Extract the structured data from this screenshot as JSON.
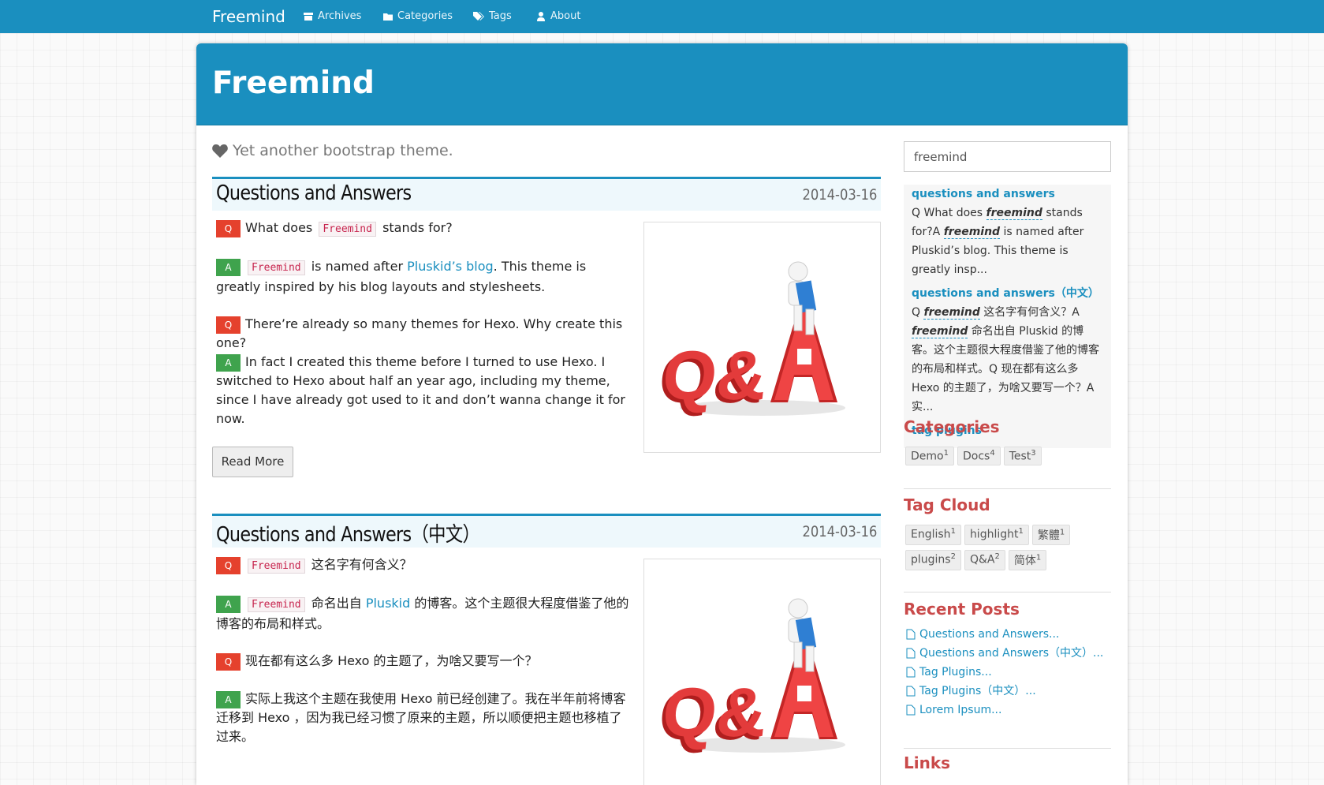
{
  "navbar": {
    "brand": "Freemind",
    "items": [
      {
        "label": "Archives",
        "icon": "archive-icon"
      },
      {
        "label": "Categories",
        "icon": "folder-icon"
      },
      {
        "label": "Tags",
        "icon": "tags-icon"
      },
      {
        "label": "About",
        "icon": "user-icon"
      }
    ]
  },
  "banner": {
    "title": "Freemind"
  },
  "subtitle": "Yet another bootstrap theme.",
  "posts": [
    {
      "title": "Questions and Answers",
      "date": "2014-03-16",
      "q1_kw": "Freemind",
      "q1_text": "stands for?",
      "q1_pre": "What does",
      "a1_kw": "Freemind",
      "a1_pre": "is named after",
      "a1_link": "Pluskid’s blog",
      "a1_text": ". This theme is greatly inspired by his blog layouts and stylesheets.",
      "q2_text": "There’re already so many themes for Hexo. Why create this one?",
      "a2_text": "In fact I created this theme before I turned to use Hexo. I switched to Hexo about half an year ago, including my theme, since I have already got used to it and don’t wanna change it for now.",
      "badge_q": "Q",
      "badge_a": "A",
      "read_more": "Read More"
    },
    {
      "title": "Questions and Answers（中文）",
      "date": "2014-03-16",
      "q1_kw": "Freemind",
      "q1_text": "这名字有何含义？",
      "a1_kw": "Freemind",
      "a1_pre": "命名出自",
      "a1_link": "Pluskid",
      "a1_text": "的博客。这个主题很大程度借鉴了他的博客的布局和样式。",
      "q2_text": "现在都有这么多 Hexo 的主题了，为啥又要写一个？",
      "a2_text": "实际上我这个主题在我使用 Hexo 前已经创建了。我在半年前将博客迁移到 Hexo ，因为我已经习惯了原来的主题，所以顺便把主题也移植了过来。",
      "badge_q": "Q",
      "badge_a": "A"
    }
  ],
  "sidebar": {
    "search_value": "freemind",
    "search_results": [
      {
        "title": "questions and answers",
        "text_parts": [
          "Q What does ",
          "freemind",
          " stands for?A ",
          "freemind",
          " is named after Pluskid’s blog. This theme is greatly insp..."
        ]
      },
      {
        "title": "questions and answers（中文）",
        "text_parts": [
          "Q ",
          "freemind",
          " 这名字有何含义？A ",
          "freemind",
          " 命名出自 Pluskid 的博客。这个主题很大程度借鉴了他的博客的布局和样式。Q 现在都有这么多 Hexo 的主题了，为啥又要写一个？A 实..."
        ]
      },
      {
        "title": "tag plugins"
      }
    ],
    "categories_heading": "Categories",
    "categories": [
      {
        "name": "Demo",
        "count": "1"
      },
      {
        "name": "Docs",
        "count": "4"
      },
      {
        "name": "Test",
        "count": "3"
      }
    ],
    "tagcloud_heading": "Tag Cloud",
    "tags_row1": [
      {
        "name": "English",
        "count": "1"
      },
      {
        "name": "highlight",
        "count": "1"
      },
      {
        "name": "繁體",
        "count": "1"
      }
    ],
    "tags_row2": [
      {
        "name": "plugins",
        "count": "2"
      },
      {
        "name": "Q&A",
        "count": "2"
      },
      {
        "name": "简体",
        "count": "1"
      }
    ],
    "recent_heading": "Recent Posts",
    "recent_posts": [
      "Questions and Answers...",
      "Questions and Answers（中文）...",
      "Tag Plugins...",
      "Tag Plugins（中文）...",
      "Lorem Ipsum..."
    ],
    "links_heading": "Links"
  },
  "colors": {
    "accent": "#1a8fbf",
    "heading_red": "#c94a4a",
    "badge_q": "#e5412d",
    "badge_a": "#3fa34d"
  }
}
